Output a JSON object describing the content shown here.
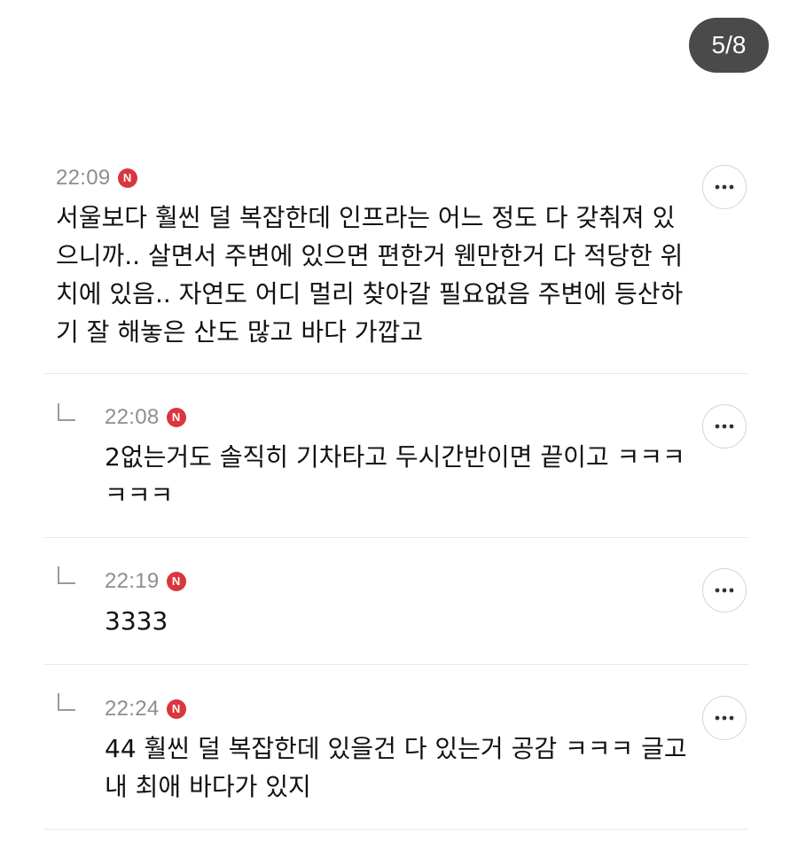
{
  "page_indicator": "5/8",
  "comments": [
    {
      "time": "22:09",
      "badge": "N",
      "text": "서울보다 훨씬 덜 복잡한데 인프라는 어느 정도 다 갖춰져 있으니까.. 살면서 주변에 있으면 편한거 웬만한거 다 적당한 위치에 있음.. 자연도 어디 멀리 찾아갈 필요없음 주변에 등산하기 잘 해놓은 산도 많고 바다 가깝고",
      "is_reply": false
    },
    {
      "time": "22:08",
      "badge": "N",
      "text": "2없는거도 솔직히 기차타고 두시간반이면 끝이고 ㅋㅋㅋㅋㅋㅋ",
      "is_reply": true
    },
    {
      "time": "22:19",
      "badge": "N",
      "text": "3333",
      "is_reply": true
    },
    {
      "time": "22:24",
      "badge": "N",
      "text": "44 훨씬 덜 복잡한데 있을건 다 있는거 공감 ㅋㅋㅋ 글고 내 최애 바다가 있지",
      "is_reply": true
    }
  ],
  "icons": {
    "more": "more-options-icon",
    "reply": "reply-arrow-icon",
    "badge": "new-badge"
  },
  "colors": {
    "badge": "#d9363e",
    "indicator_bg": "#4a4a4a",
    "time_text": "#8e8e8e",
    "divider": "#e9e9e9"
  }
}
